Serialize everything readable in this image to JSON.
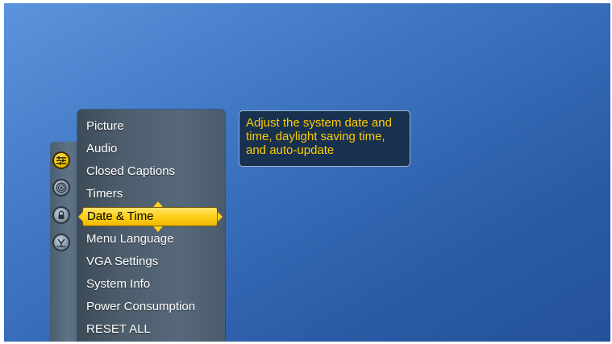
{
  "colors": {
    "background_accent": "#3d74c0",
    "selection": "#ffd21a",
    "tooltip_text": "#ffcc00",
    "tooltip_bg": "#17314f"
  },
  "rail": {
    "icons": [
      {
        "name": "settings-sliders-icon",
        "active": true
      },
      {
        "name": "antenna-signal-icon",
        "active": false
      },
      {
        "name": "lock-icon",
        "active": false
      },
      {
        "name": "input-source-icon",
        "active": false
      }
    ]
  },
  "menu": {
    "items": [
      {
        "label": "Picture"
      },
      {
        "label": "Audio"
      },
      {
        "label": "Closed Captions"
      },
      {
        "label": "Timers"
      },
      {
        "label": "Date & Time"
      },
      {
        "label": "Menu Language"
      },
      {
        "label": "VGA Settings"
      },
      {
        "label": "System Info"
      },
      {
        "label": "Power Consumption"
      },
      {
        "label": "RESET ALL"
      }
    ],
    "selected_label": "Date & Time"
  },
  "tooltip": {
    "text": "Adjust the system date and time, daylight saving time, and auto-update"
  }
}
